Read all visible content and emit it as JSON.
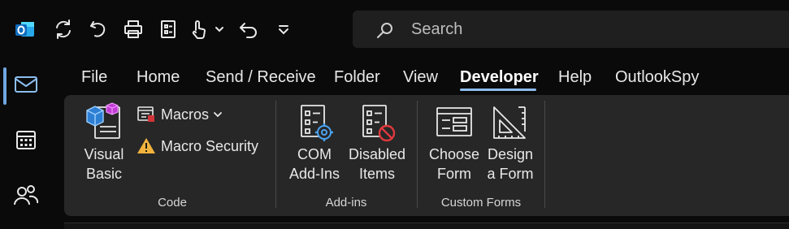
{
  "search": {
    "placeholder": "Search"
  },
  "tabs": [
    {
      "label": "File"
    },
    {
      "label": "Home"
    },
    {
      "label": "Send / Receive"
    },
    {
      "label": "Folder"
    },
    {
      "label": "View"
    },
    {
      "label": "Developer",
      "active": true
    },
    {
      "label": "Help"
    },
    {
      "label": "OutlookSpy"
    }
  ],
  "ribbon": {
    "code": {
      "visual_basic": {
        "line1": "Visual",
        "line2": "Basic"
      },
      "macros": "Macros",
      "macro_security": "Macro Security",
      "label": "Code"
    },
    "addins": {
      "com": {
        "line1": "COM",
        "line2": "Add-Ins"
      },
      "disabled": {
        "line1": "Disabled",
        "line2": "Items"
      },
      "label": "Add-ins"
    },
    "forms": {
      "choose": {
        "line1": "Choose",
        "line2": "Form"
      },
      "design": {
        "line1": "Design",
        "line2": "a Form"
      },
      "label": "Custom Forms"
    }
  },
  "colors": {
    "background": "#0a0a0a",
    "ribbon": "#272727",
    "accent": "#8cbdf0",
    "outlook_blue": "#0f6cbd",
    "warning": "#f2b33d"
  },
  "icons": [
    "outlook-logo-icon",
    "sync-icon",
    "undo-icon",
    "print-icon",
    "form-icon",
    "touch-mode-icon",
    "chevron-down-icon",
    "undo-arrow-icon",
    "customize-icon",
    "search-icon",
    "mail-icon",
    "calendar-icon",
    "people-icon",
    "visual-basic-icon",
    "macros-icon",
    "warning-icon",
    "com-addins-icon",
    "disabled-items-icon",
    "choose-form-icon",
    "design-form-icon"
  ]
}
